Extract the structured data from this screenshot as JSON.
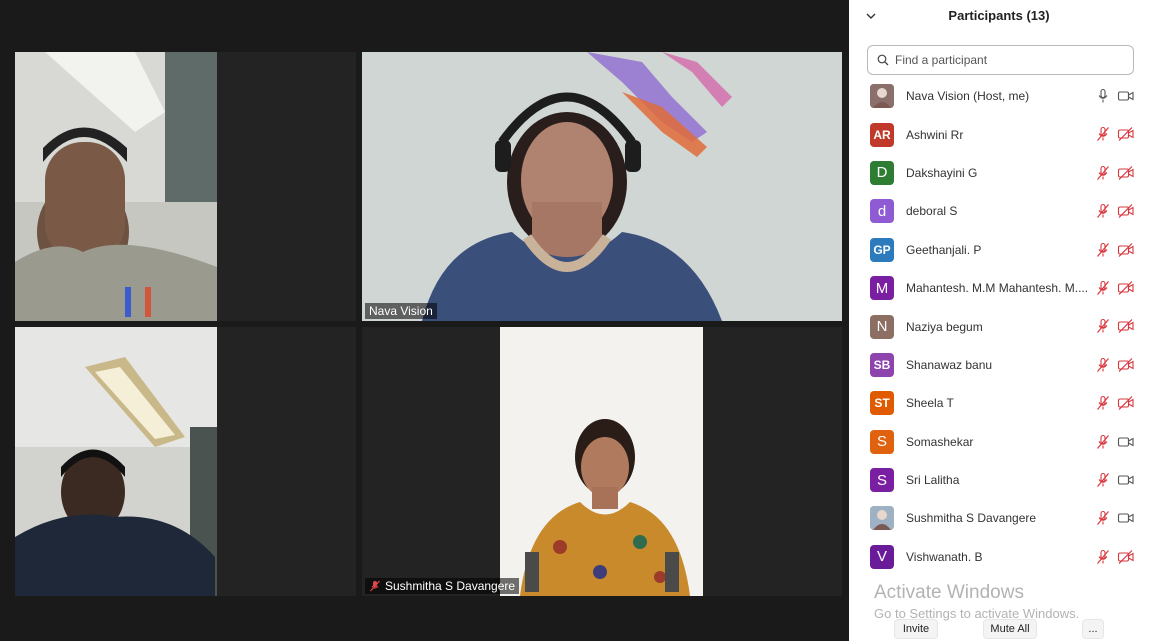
{
  "panel": {
    "title": "Participants (13)",
    "search_placeholder": "Find a participant",
    "participants": [
      {
        "name": "Nava Vision (Host, me)",
        "initials": "",
        "avatar_color": "#8a6f6a",
        "mic_muted": false,
        "video_off": false
      },
      {
        "name": "Ashwini Rr",
        "initials": "AR",
        "avatar_color": "#c0392b",
        "mic_muted": true,
        "video_off": true
      },
      {
        "name": "Dakshayini G",
        "initials": "D",
        "avatar_color": "#2e7d32",
        "mic_muted": true,
        "video_off": true
      },
      {
        "name": "deboral S",
        "initials": "d",
        "avatar_color": "#8e5bd4",
        "mic_muted": true,
        "video_off": true
      },
      {
        "name": "Geethanjali. P",
        "initials": "GP",
        "avatar_color": "#2b7bbd",
        "mic_muted": true,
        "video_off": true
      },
      {
        "name": "Mahantesh. M.M Mahantesh. M....",
        "initials": "M",
        "avatar_color": "#7b1fa2",
        "mic_muted": true,
        "video_off": true
      },
      {
        "name": "Naziya begum",
        "initials": "N",
        "avatar_color": "#8d6e63",
        "mic_muted": true,
        "video_off": true
      },
      {
        "name": "Shanawaz banu",
        "initials": "SB",
        "avatar_color": "#8e44ad",
        "mic_muted": true,
        "video_off": true
      },
      {
        "name": "Sheela T",
        "initials": "ST",
        "avatar_color": "#e05a00",
        "mic_muted": true,
        "video_off": true
      },
      {
        "name": "Somashekar",
        "initials": "S",
        "avatar_color": "#e0610e",
        "mic_muted": true,
        "video_off": false
      },
      {
        "name": "Sri Lalitha",
        "initials": "S",
        "avatar_color": "#7b1fa2",
        "mic_muted": true,
        "video_off": false
      },
      {
        "name": "Sushmitha S Davangere",
        "initials": "",
        "avatar_color": "#9fb2c4",
        "mic_muted": true,
        "video_off": false
      },
      {
        "name": "Vishwanath. B",
        "initials": "V",
        "avatar_color": "#6a1b9a",
        "mic_muted": true,
        "video_off": true
      }
    ],
    "watermark_title": "Activate Windows",
    "watermark_sub": "Go to Settings to activate Windows.",
    "footer": {
      "invite": "Invite",
      "mute_all": "Mute All",
      "more": "..."
    }
  },
  "videos": {
    "tile2_name": "Nava Vision",
    "tile4_name": "Sushmitha S Davangere"
  },
  "colors": {
    "muted_red": "#d9363e",
    "icon_gray": "#555555"
  }
}
